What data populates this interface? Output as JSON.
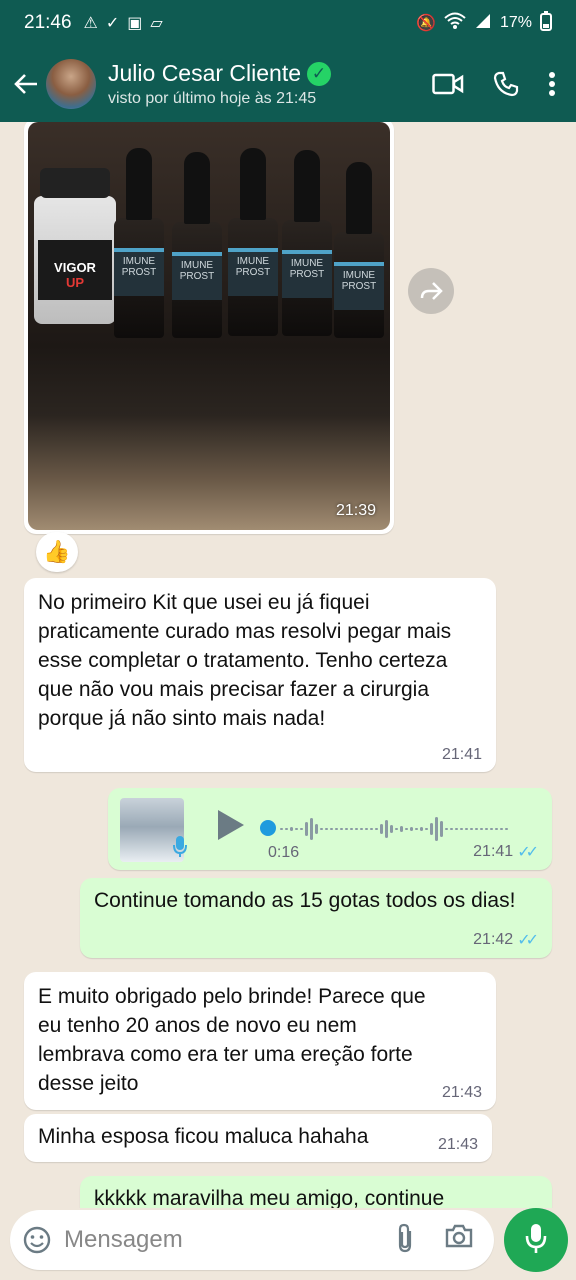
{
  "status_bar": {
    "time": "21:46",
    "battery": "17%"
  },
  "header": {
    "contact_name": "Julio Cesar Cliente",
    "last_seen": "visto por último hoje às 21:45"
  },
  "messages": {
    "image": {
      "time": "21:39",
      "reaction": "👍",
      "jar_label_1": "VIGOR",
      "jar_label_2": "UP",
      "bottle_label": "IMUNE PROST"
    },
    "msg1": {
      "text": "No primeiro Kit que usei eu já fiquei praticamente curado mas resolvi pegar mais esse completar o tratamento. Tenho certeza que não vou mais precisar fazer a cirurgia porque já não sinto mais nada!",
      "time": "21:41"
    },
    "voice": {
      "duration": "0:16",
      "time": "21:41"
    },
    "msg2": {
      "text": "Continue tomando as 15 gotas todos os dias!",
      "time": "21:42"
    },
    "msg3": {
      "text": "E muito obrigado pelo brinde! Parece que eu tenho 20 anos de novo eu nem lembrava como era ter uma ereção forte desse jeito",
      "time": "21:43"
    },
    "msg4": {
      "text": "Minha esposa ficou maluca hahaha",
      "time": "21:43"
    },
    "msg5": {
      "text": "kkkkk maravilha meu amigo, continue"
    }
  },
  "composer": {
    "placeholder": "Mensagem"
  },
  "colors": {
    "header_bg": "#0f5b52",
    "outgoing_bubble": "#d9fdd3",
    "accent_green": "#1fa855",
    "read_ticks": "#53bdeb"
  }
}
